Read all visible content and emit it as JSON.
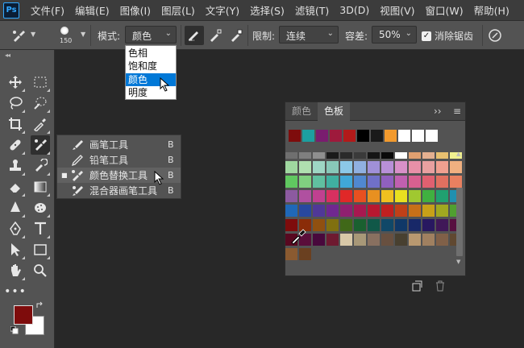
{
  "app_logo": "Ps",
  "menu": [
    "文件(F)",
    "编辑(E)",
    "图像(I)",
    "图层(L)",
    "文字(Y)",
    "选择(S)",
    "滤镜(T)",
    "3D(D)",
    "视图(V)",
    "窗口(W)",
    "帮助(H)"
  ],
  "options": {
    "brush_size": "150",
    "mode_label": "模式:",
    "mode_value": "颜色",
    "limit_label": "限制:",
    "limit_value": "连续",
    "tolerance_label": "容差:",
    "tolerance_value": "50%",
    "antialias_label": "消除锯齿",
    "antialias_checked": true
  },
  "mode_menu": {
    "options": [
      "色相",
      "饱和度",
      "颜色",
      "明度"
    ],
    "selected_index": 2
  },
  "flyout": {
    "items": [
      {
        "label": "画笔工具",
        "key": "B",
        "icon": "brush-icon"
      },
      {
        "label": "铅笔工具",
        "key": "B",
        "icon": "pencil-icon"
      },
      {
        "label": "颜色替换工具",
        "key": "B",
        "icon": "color-replacement-icon",
        "bullet": "■"
      },
      {
        "label": "混合器画笔工具",
        "key": "B",
        "icon": "mixer-brush-icon"
      }
    ],
    "selected_index": 2
  },
  "toolbar": {
    "foreground_color": "#7e0c0c",
    "background_color": "#ffffff"
  },
  "panel": {
    "tabs": [
      "颜色",
      "色板"
    ],
    "active_tab": 1,
    "menu_glyph": "≡",
    "collapse_glyph": "››",
    "recent_swatches": [
      "#7e0c0c",
      "#1d9fa0",
      "#7a1d6f",
      "#9e1a3c",
      "#b21a1a",
      "#000000",
      "#1a1a1a",
      "#f29a2e",
      "#ffffff",
      "#ffffff",
      "#ffffff"
    ],
    "swatch_rows": [
      [
        "#6f6f6f",
        "#7f7f7f",
        "#8f8f8f",
        "#1a1a1a",
        "#2a2a2a",
        "#3a3a3a",
        "#151515",
        "#0a0a0a",
        "#ffffff",
        "#e0a070",
        "#e4b090",
        "#e8c070",
        "#f0f090"
      ],
      [
        "#a0d8a0",
        "#b0e0b0",
        "#9ed6c4",
        "#88c8b8",
        "#8cc8e8",
        "#90b0e0",
        "#a090d8",
        "#b890d8",
        "#d890c8",
        "#e890a8",
        "#e8a0a0",
        "#f0a090",
        "#f0b080"
      ],
      [
        "#60c860",
        "#80d080",
        "#60c0a0",
        "#40b0a0",
        "#40a8d8",
        "#5088d0",
        "#7070c8",
        "#9060c0",
        "#c060b0",
        "#d86090",
        "#e06070",
        "#e07060",
        "#e88060"
      ],
      [
        "#8c5aa0",
        "#b050a0",
        "#c04090",
        "#d83060",
        "#e02828",
        "#e85020",
        "#e89020",
        "#f0c020",
        "#e8e020",
        "#a0c830",
        "#40b040",
        "#20a070",
        "#2090b0"
      ],
      [
        "#2068b8",
        "#2848a0",
        "#503898",
        "#702890",
        "#902070",
        "#a81850",
        "#b81830",
        "#c02020",
        "#c04018",
        "#c87018",
        "#c8a018",
        "#a0a820",
        "#50a030"
      ],
      [
        "#7e0c0c",
        "#8a2c08",
        "#905010",
        "#807010",
        "#406818",
        "#1a6030",
        "#105848",
        "#104868",
        "#103868",
        "#182868",
        "#281860",
        "#401858",
        "#581040"
      ],
      [
        "#580820",
        "#5a0e3a",
        "#48083c",
        "#6e1a30",
        "#d8c8a8",
        "#a89878",
        "#887060",
        "#685040",
        "#484030",
        "#b89870",
        "#a08060",
        "#806048",
        "#604830"
      ],
      [
        "#8a5a30",
        "#6a4020"
      ]
    ]
  }
}
